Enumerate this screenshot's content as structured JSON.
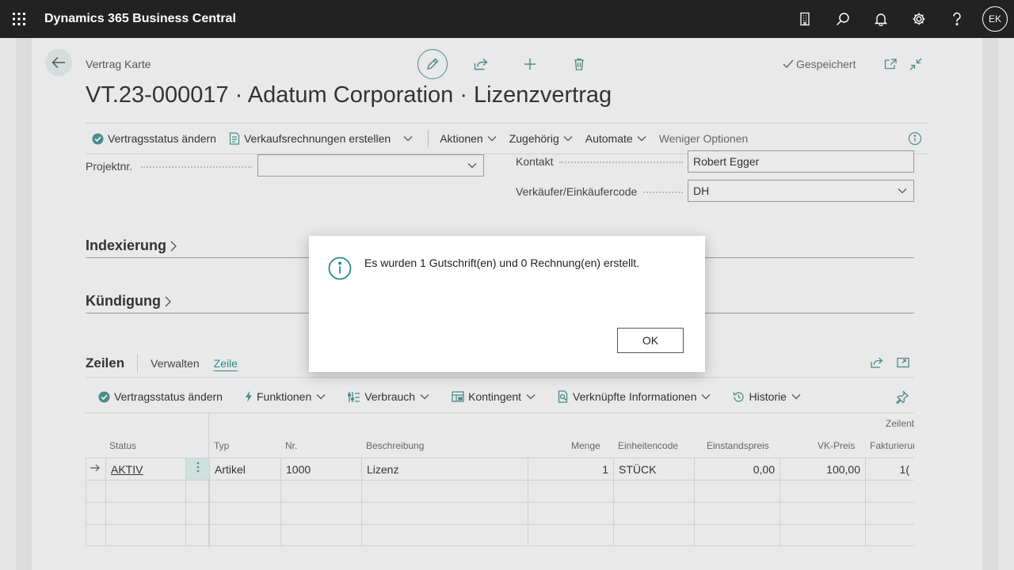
{
  "app": {
    "title": "Dynamics 365 Business Central",
    "user_initials": "EK"
  },
  "page": {
    "breadcrumb": "Vertrag Karte",
    "title": "VT.23-000017 · Adatum Corporation · Lizenzvertrag",
    "saved_label": "Gespeichert"
  },
  "action_bar": {
    "change_status": "Vertragsstatus ändern",
    "create_invoices": "Verkaufsrechnungen erstellen",
    "actions": "Aktionen",
    "related": "Zugehörig",
    "automate": "Automate",
    "fewer_options": "Weniger Optionen"
  },
  "fields": {
    "project_no": {
      "label": "Projektnr.",
      "value": ""
    },
    "contact": {
      "label": "Kontakt",
      "value": "Robert Egger"
    },
    "salesperson": {
      "label": "Verkäufer/Einkäufercode",
      "value": "DH"
    }
  },
  "sections": {
    "indexing": "Indexierung",
    "termination": "Kündigung"
  },
  "lines": {
    "title": "Zeilen",
    "tabs": [
      "Verwalten",
      "Zeile"
    ],
    "actions": {
      "change_status": "Vertragsstatus ändern",
      "functions": "Funktionen",
      "consumption": "Verbrauch",
      "quota": "Kontingent",
      "linked_info": "Verknüpfte Informationen",
      "history": "Historie"
    },
    "group_header": "Zeilenb",
    "columns": {
      "status": "Status",
      "type": "Typ",
      "no": "Nr.",
      "description": "Beschreibung",
      "quantity": "Menge",
      "unit_code": "Einheitencode",
      "unit_cost": "Einstandspreis",
      "sales_price": "VK-Preis",
      "invoicing": "Fakturierun"
    },
    "rows": [
      {
        "status": "AKTIV",
        "type": "Artikel",
        "no": "1000",
        "description": "Lizenz",
        "quantity": "1",
        "unit_code": "STÜCK",
        "unit_cost": "0,00",
        "sales_price": "100,00",
        "invoicing": "1("
      }
    ]
  },
  "dialog": {
    "message": "Es wurden 1 Gutschrift(en) und 0 Rechnung(en) erstellt.",
    "ok_label": "OK"
  },
  "colors": {
    "accent": "#2a8b8b",
    "topbar": "#222222"
  }
}
